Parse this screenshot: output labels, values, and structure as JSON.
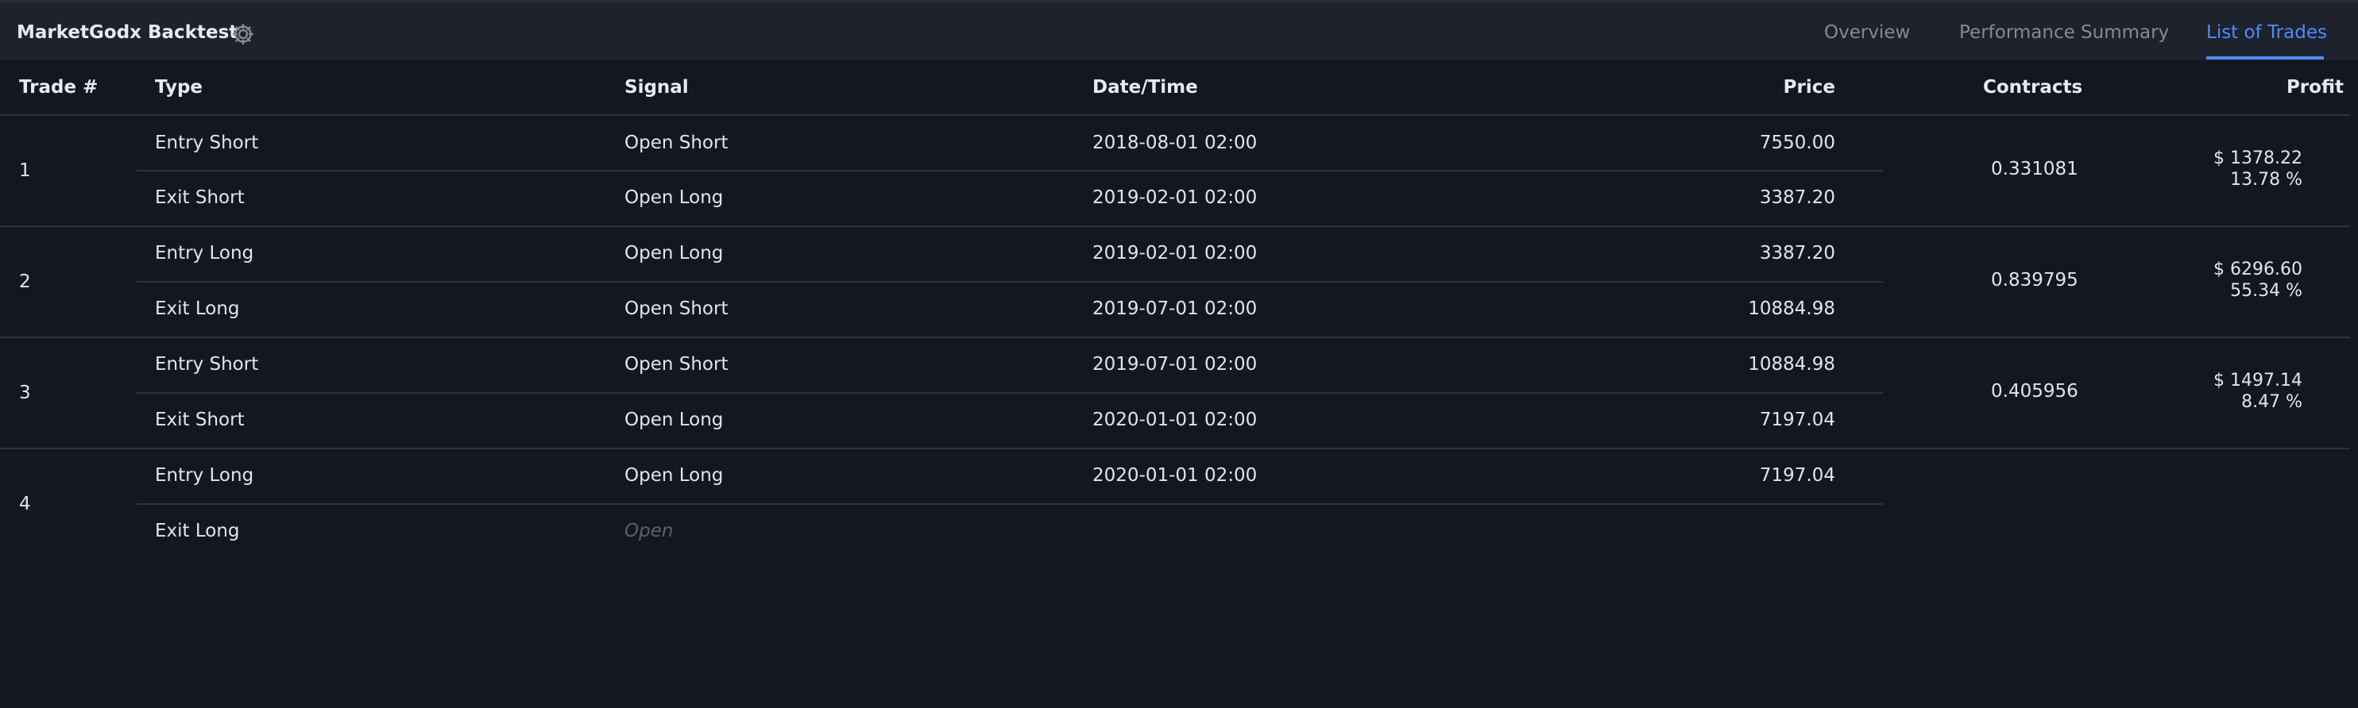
{
  "app": {
    "title": "MarketGodx Backtest",
    "settings_icon": "gear-icon"
  },
  "tabs": [
    {
      "label": "Overview",
      "active": false
    },
    {
      "label": "Performance Summary",
      "active": false
    },
    {
      "label": "List of Trades",
      "active": true
    }
  ],
  "colors": {
    "background": "#131722",
    "topbar": "#1e222d",
    "accent": "#4c8ef7",
    "divider": "#2e3240"
  },
  "table": {
    "headers": {
      "trade": "Trade #",
      "type": "Type",
      "signal": "Signal",
      "datetime": "Date/Time",
      "price": "Price",
      "contracts": "Contracts",
      "profit": "Profit"
    },
    "trades": [
      {
        "number": "1",
        "entry": {
          "type": "Entry Short",
          "signal": "Open Short",
          "datetime": "2018-08-01 02:00",
          "price": "7550.00"
        },
        "exit": {
          "type": "Exit Short",
          "signal": "Open Long",
          "datetime": "2019-02-01 02:00",
          "price": "3387.20"
        },
        "contracts": "0.331081",
        "profit": "$ 1378.22",
        "profit_pct": "13.78 %"
      },
      {
        "number": "2",
        "entry": {
          "type": "Entry Long",
          "signal": "Open Long",
          "datetime": "2019-02-01 02:00",
          "price": "3387.20"
        },
        "exit": {
          "type": "Exit Long",
          "signal": "Open Short",
          "datetime": "2019-07-01 02:00",
          "price": "10884.98"
        },
        "contracts": "0.839795",
        "profit": "$ 6296.60",
        "profit_pct": "55.34 %"
      },
      {
        "number": "3",
        "entry": {
          "type": "Entry Short",
          "signal": "Open Short",
          "datetime": "2019-07-01 02:00",
          "price": "10884.98"
        },
        "exit": {
          "type": "Exit Short",
          "signal": "Open Long",
          "datetime": "2020-01-01 02:00",
          "price": "7197.04"
        },
        "contracts": "0.405956",
        "profit": "$ 1497.14",
        "profit_pct": "8.47 %"
      },
      {
        "number": "4",
        "entry": {
          "type": "Entry Long",
          "signal": "Open Long",
          "datetime": "2020-01-01 02:00",
          "price": "7197.04"
        },
        "exit": {
          "type": "Exit Long",
          "signal": "Open",
          "datetime": "",
          "price": ""
        },
        "contracts": "",
        "profit": "",
        "profit_pct": ""
      }
    ]
  }
}
